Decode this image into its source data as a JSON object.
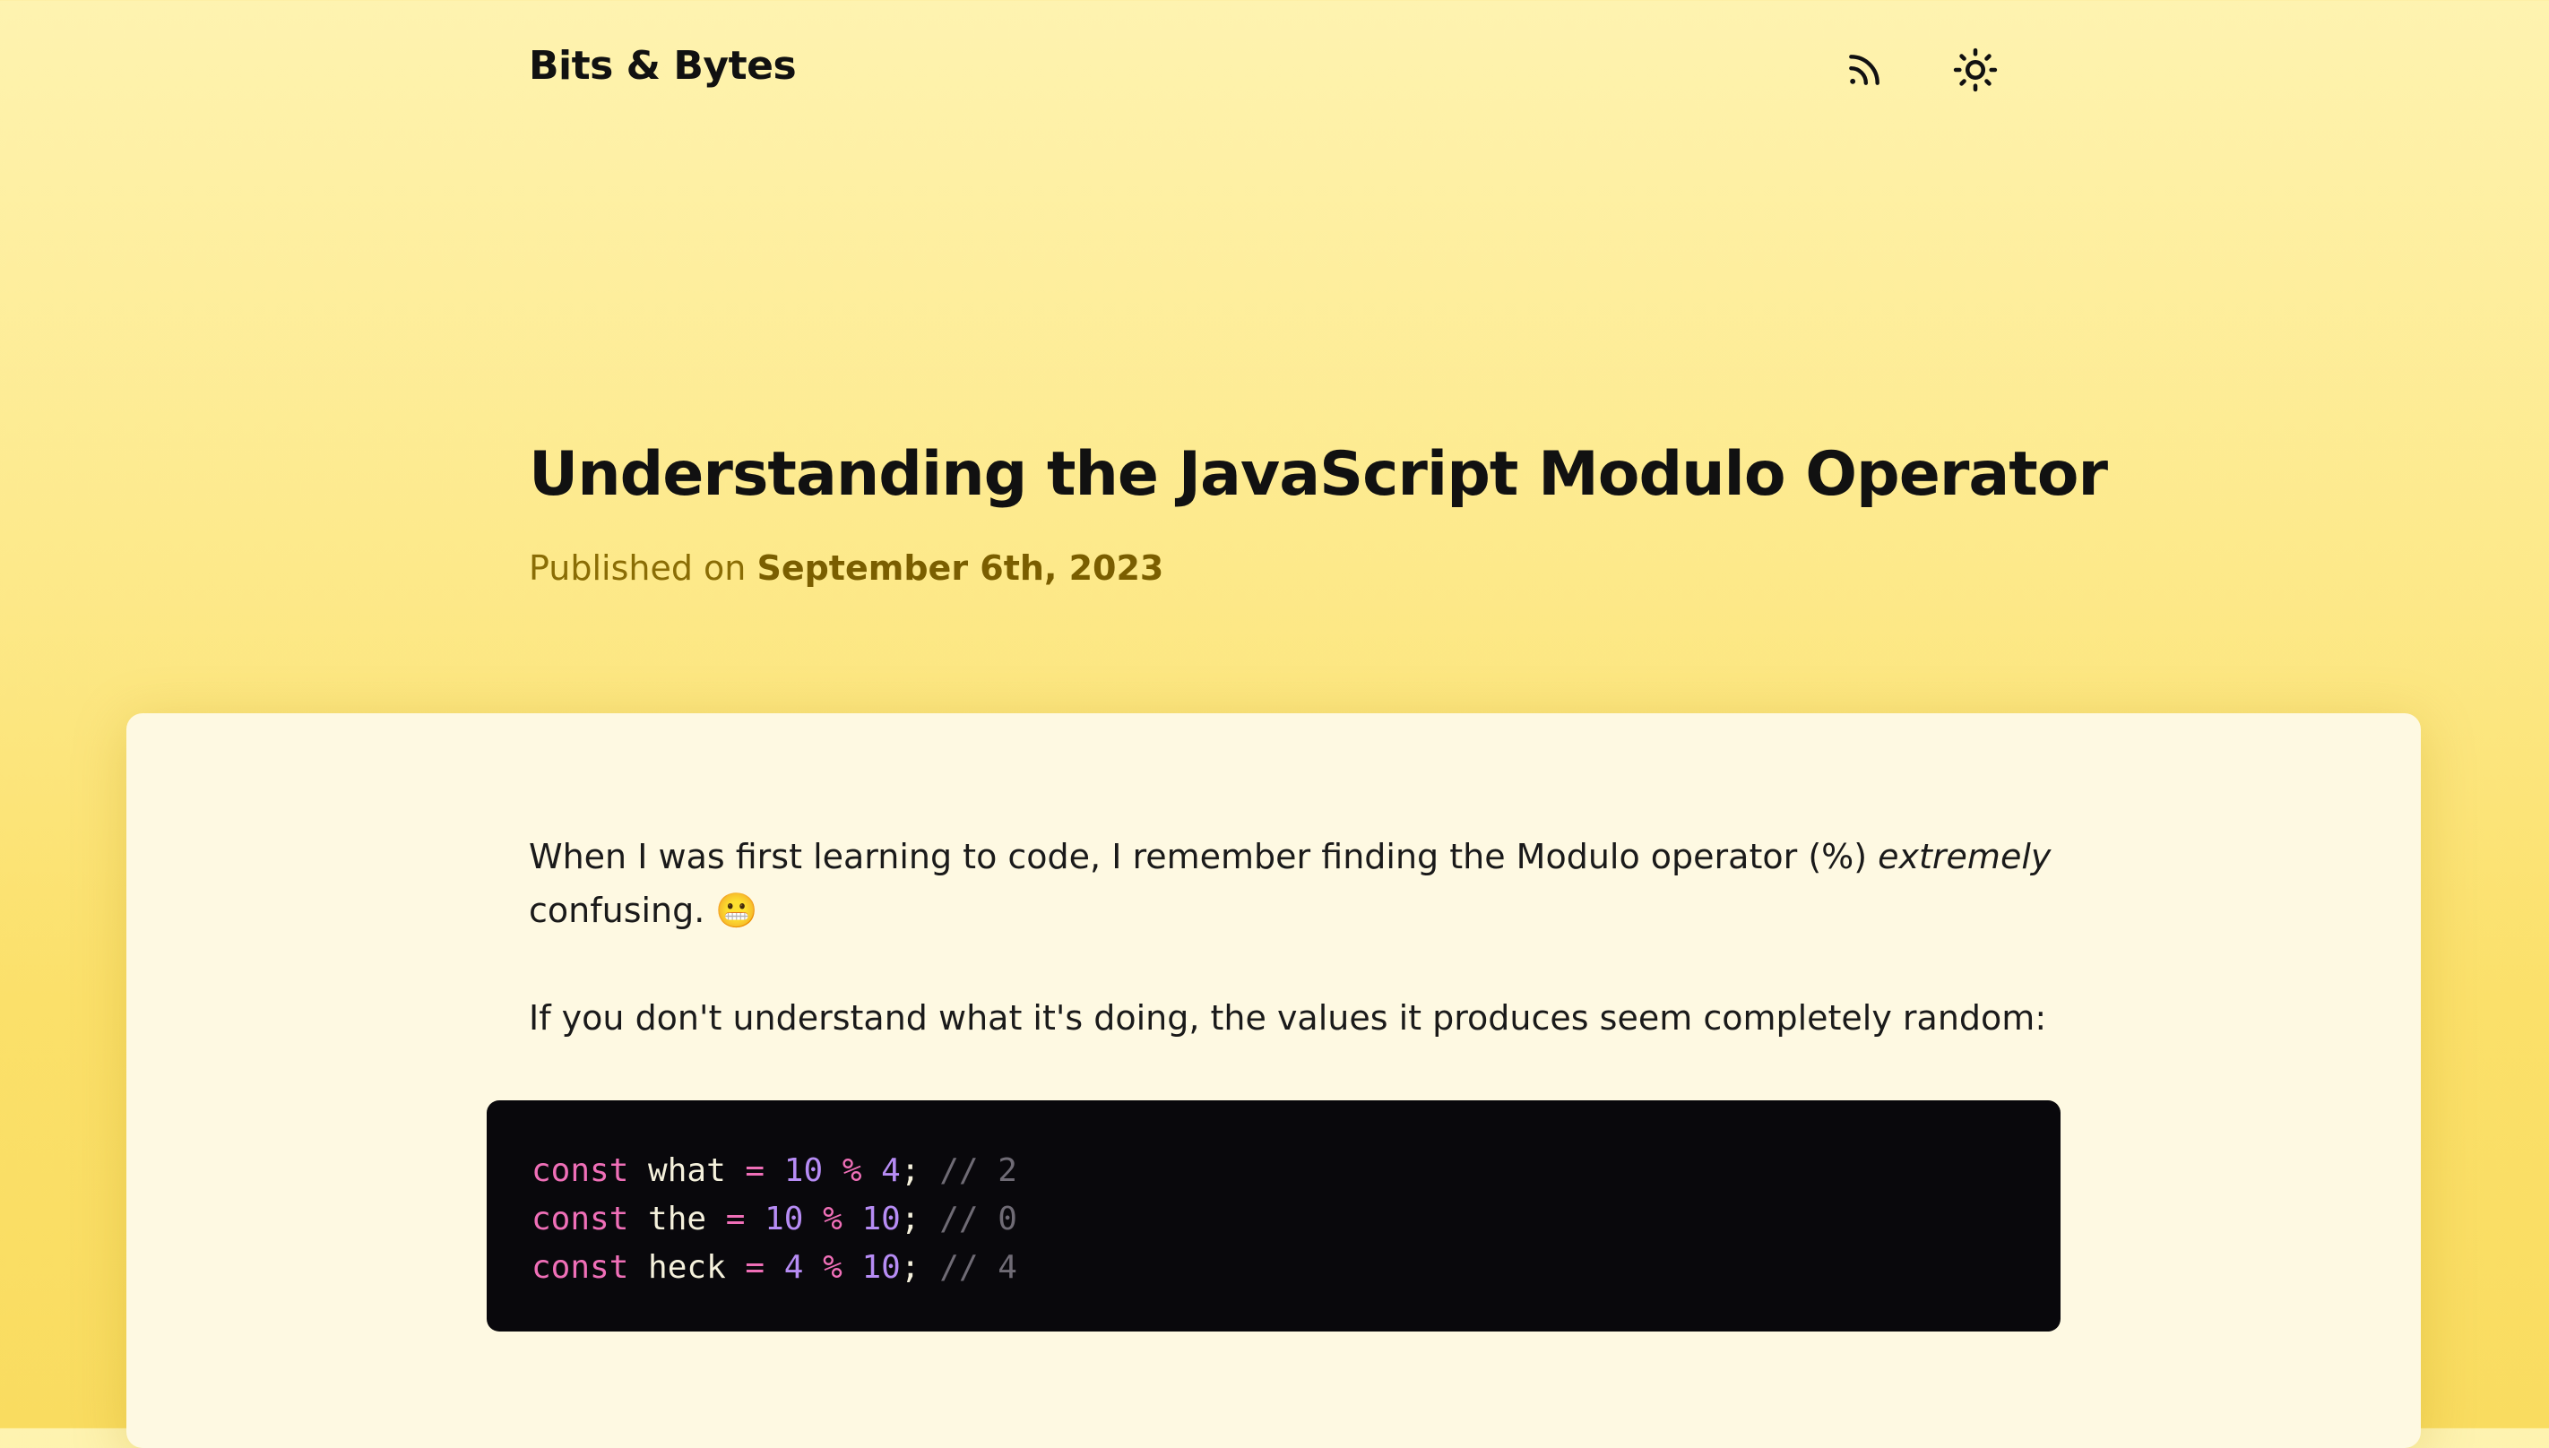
{
  "header": {
    "site_title": "Bits & Bytes",
    "icons": [
      "rss-icon",
      "sun-icon"
    ]
  },
  "article": {
    "title": "Understanding the JavaScript Modulo Operator",
    "published_prefix": "Published on",
    "published_date": "September 6th, 2023",
    "para1_before": "When I was first learning to code, I remember finding the Modulo operator (%) ",
    "para1_em": "extremely",
    "para1_after": " confusing. 😬",
    "para2": "If you don't understand what it's doing, the values it produces seem completely random:",
    "code": [
      {
        "kw": "const",
        "name": " what ",
        "eq": "=",
        "a": " 10",
        "op": " %",
        "b": " 4",
        "semi": ";",
        "comment": " // 2"
      },
      {
        "kw": "const",
        "name": " the ",
        "eq": "=",
        "a": " 10",
        "op": " %",
        "b": " 10",
        "semi": ";",
        "comment": " // 0"
      },
      {
        "kw": "const",
        "name": " heck ",
        "eq": "=",
        "a": " 4",
        "op": " %",
        "b": " 10",
        "semi": ";",
        "comment": " // 4"
      }
    ]
  }
}
